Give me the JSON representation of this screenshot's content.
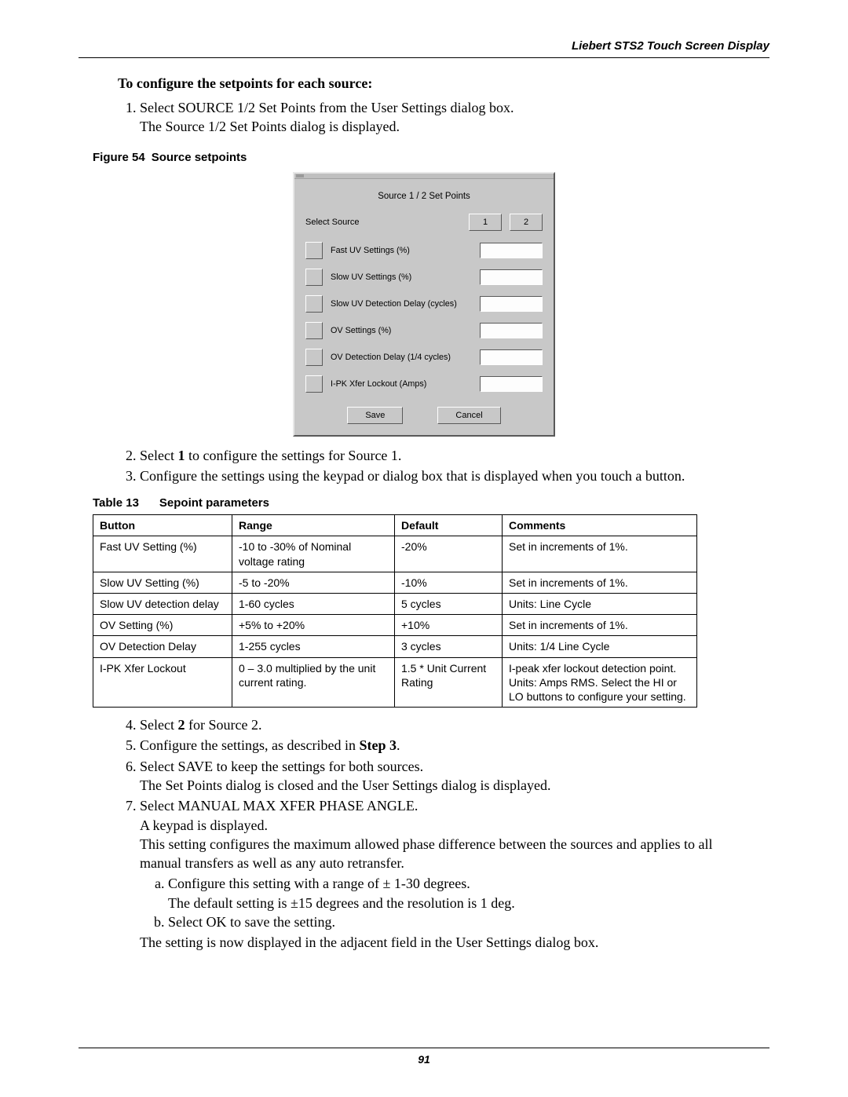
{
  "header": "Liebert STS2 Touch Screen Display",
  "sectionTitle": "To configure the setpoints for each source:",
  "step1a": "Select SOURCE 1/2 Set Points from the User Settings dialog box.",
  "step1b": "The Source 1/2 Set Points dialog is displayed.",
  "figLabel": "Figure 54",
  "figTitle": "Source setpoints",
  "dialog": {
    "title": "Source 1 / 2 Set Points",
    "selectLabel": "Select Source",
    "btn1": "1",
    "btn2": "2",
    "fields": {
      "f0": "Fast UV Settings (%)",
      "f1": "Slow UV Settings (%)",
      "f2": "Slow UV Detection Delay (cycles)",
      "f3": "OV Settings (%)",
      "f4": "OV Detection Delay (1/4 cycles)",
      "f5": "I-PK Xfer Lockout (Amps)"
    },
    "save": "Save",
    "cancel": "Cancel"
  },
  "step2_pre": "Select ",
  "step2_bold": "1",
  "step2_post": " to configure the settings for Source 1.",
  "step3": "Configure the settings using the keypad or dialog box that is displayed when you touch a button.",
  "tblLabel": "Table 13",
  "tblTitle": "Sepoint parameters",
  "tbl": {
    "h0": "Button",
    "h1": "Range",
    "h2": "Default",
    "h3": "Comments",
    "r0c0": "Fast UV Setting (%)",
    "r0c1": "-10 to -30% of Nominal voltage rating",
    "r0c2": "-20%",
    "r0c3": "Set in increments of 1%.",
    "r1c0": "Slow UV Setting (%)",
    "r1c1": "-5 to -20%",
    "r1c2": "-10%",
    "r1c3": "Set in increments of 1%.",
    "r2c0": "Slow UV detection delay",
    "r2c1": "1-60 cycles",
    "r2c2": "5 cycles",
    "r2c3": "Units: Line Cycle",
    "r3c0": "OV Setting (%)",
    "r3c1": "+5% to +20%",
    "r3c2": "+10%",
    "r3c3": "Set in increments of 1%.",
    "r4c0": "OV Detection Delay",
    "r4c1": "1-255 cycles",
    "r4c2": "3 cycles",
    "r4c3": "Units: 1/4 Line Cycle",
    "r5c0": "I-PK Xfer Lockout",
    "r5c1": "0 – 3.0 multiplied by the unit current rating.",
    "r5c2": "1.5 * Unit Current Rating",
    "r5c3": "I-peak xfer lockout detection point. Units: Amps RMS. Select the HI or LO buttons to configure your setting."
  },
  "step4_pre": "Select ",
  "step4_bold": "2",
  "step4_post": " for Source 2.",
  "step5_pre": "Configure the settings, as described in ",
  "step5_bold": "Step 3",
  "step5_post": ".",
  "step6a": "Select SAVE to keep the settings for both sources.",
  "step6b": "The Set Points dialog is closed and the User Settings dialog is displayed.",
  "step7a": "Select MANUAL MAX XFER PHASE ANGLE.",
  "step7b": "A keypad is displayed.",
  "step7c": "This setting configures the maximum allowed phase difference between the sources and applies to all manual transfers as well as any auto retransfer.",
  "step7sub_a1": "Configure this setting with a range of ± 1-30 degrees.",
  "step7sub_a2": "The default setting is ±15 degrees and the resolution is 1 deg.",
  "step7sub_b": "Select OK to save the setting.",
  "step7d": "The setting is now displayed in the adjacent field in the User Settings dialog box.",
  "pageNum": "91"
}
